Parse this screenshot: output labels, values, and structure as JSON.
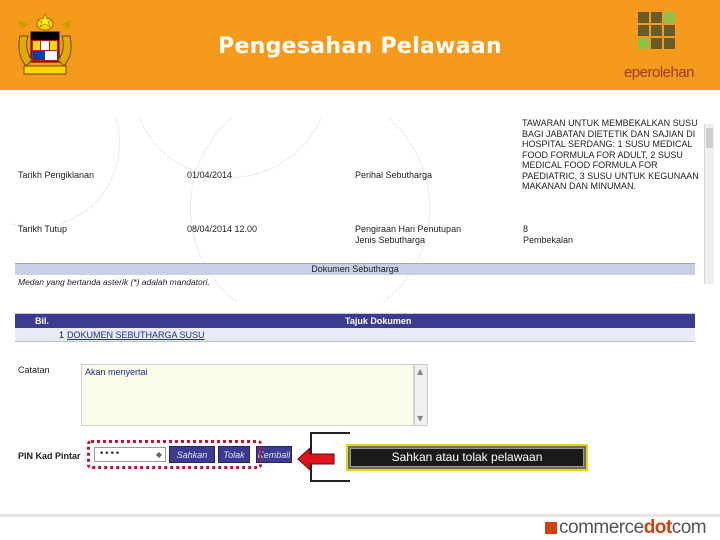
{
  "header": {
    "title": "Pengesahan Pelawaan",
    "brand": "eperolehan",
    "accent_color": "#f59a1a"
  },
  "form": {
    "fields": [
      {
        "label": "Tarikh Pengiklanan",
        "value": "01/04/2014"
      },
      {
        "label": "Tarikh Tutup",
        "value": "08/04/2014 12.00"
      }
    ],
    "right_labels": {
      "perihal": "Perihal Sebutharga",
      "penutupan": "Pengiraan Hari Penutupan",
      "jenis": "Jenis Sebutharga"
    },
    "right_values": {
      "penutupan": "8",
      "jenis": "Pembekalan"
    },
    "perihal_text": "TAWARAN UNTUK MEMBEKALKAN SUSU BAGI JABATAN DIETETIK DAN SAJIAN DI HOSPITAL SERDANG: 1 SUSU MEDICAL FOOD FORMULA FOR ADULT, 2 SUSU MEDICAL FOOD FORMULA FOR PAEDIATRIC, 3 SUSU UNTUK KEGUNAAN MAKANAN DAN MINUMAN."
  },
  "dokumen": {
    "section_title": "Dokumen Sebutharga",
    "mandatory_note": "Medan yang bertanda asterik (*) adalah mandatori.",
    "columns": [
      "Bil.",
      "Tajuk Dokumen"
    ],
    "rows": [
      {
        "bil": "1",
        "tajuk": "DOKUMEN SEBUTHARGA SUSU"
      }
    ]
  },
  "catatan": {
    "label": "Catatan",
    "value": "Akan menyertai"
  },
  "pin": {
    "label": "PIN Kad Pintar",
    "masked_value": "••••",
    "buttons": {
      "sahkan": "Sahkan",
      "tolak": "Tolak",
      "kembali": "Kembali"
    }
  },
  "callout": {
    "text": "Sahkan atau tolak pelawaan"
  },
  "footer": {
    "logo_part1": "commerce",
    "logo_part2": "dot",
    "logo_part3": "com"
  }
}
